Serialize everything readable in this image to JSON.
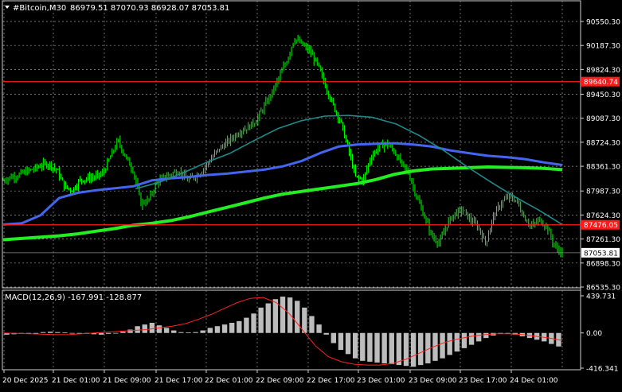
{
  "header": {
    "symbol": "#Bitcoin,M30",
    "ohlc": "86979.51 87070.93 86928.07 87053.81"
  },
  "colors": {
    "background": "#000000",
    "grid": "#9a9a9a",
    "candle": "#00ff00",
    "ma_green": "#22ee22",
    "ma_blue": "#4466ee",
    "ma_teal": "#1f8a8a",
    "hline": "#ff1a1a",
    "price_line": "#8a8a8a",
    "macd_hist": "#bdbdbd",
    "macd_signal": "#ff2020",
    "text": "#ffffff"
  },
  "chart_data": [
    {
      "type": "line",
      "title": "#Bitcoin,M30",
      "x_labels": [
        "20 Dec 2025",
        "21 Dec 01:00",
        "21 Dec 09:00",
        "21 Dec 17:00",
        "22 Dec 01:00",
        "22 Dec 09:00",
        "22 Dec 17:00",
        "23 Dec 01:00",
        "23 Dec 09:00",
        "23 Dec 17:00",
        "24 Dec 01:00"
      ],
      "y_ticks": [
        "90550.30",
        "90187.30",
        "89824.30",
        "89450.30",
        "89087.30",
        "88724.30",
        "88361.30",
        "87987.30",
        "87624.30",
        "87261.30",
        "86898.30",
        "86535.30"
      ],
      "ylim": [
        86535.3,
        90550.3
      ],
      "grid": true,
      "horizontal_lines": [
        {
          "label": "89640.74",
          "value": 89640.74
        },
        {
          "label": "87476.05",
          "value": 87476.05
        }
      ],
      "current_price": {
        "label": "87053.81",
        "value": 87053.81
      },
      "price_series": [
        88150,
        88200,
        88230,
        88280,
        88320,
        88380,
        88400,
        88300,
        88050,
        88000,
        88150,
        88180,
        88200,
        88250,
        88500,
        88750,
        88500,
        88300,
        87800,
        87850,
        88100,
        88200,
        88250,
        88300,
        88150,
        88200,
        88300,
        88450,
        88600,
        88700,
        88800,
        88900,
        88950,
        89050,
        89250,
        89450,
        89700,
        89950,
        90300,
        90200,
        90100,
        89900,
        89600,
        89300,
        89050,
        88650,
        88200,
        88150,
        88500,
        88650,
        88700,
        88600,
        88400,
        88250,
        87900,
        87600,
        87300,
        87200,
        87500,
        87650,
        87700,
        87550,
        87450,
        87200,
        87600,
        87800,
        87900,
        87850,
        87600,
        87450,
        87550,
        87450,
        87150,
        87050
      ],
      "series": [
        {
          "name": "",
          "color": "#22ee22",
          "values": [
            87250,
            87270,
            87290,
            87310,
            87340,
            87380,
            87420,
            87470,
            87500,
            87540,
            87600,
            87670,
            87740,
            87810,
            87880,
            87940,
            87980,
            88020,
            88060,
            88100,
            88160,
            88240,
            88290,
            88320,
            88330,
            88340,
            88350,
            88345,
            88340,
            88330,
            88310
          ]
        },
        {
          "name": "",
          "color": "#4466ee",
          "values": [
            87480,
            87500,
            87620,
            87880,
            87960,
            88000,
            88030,
            88060,
            88150,
            88180,
            88200,
            88230,
            88250,
            88280,
            88310,
            88360,
            88440,
            88560,
            88660,
            88690,
            88700,
            88710,
            88690,
            88660,
            88600,
            88560,
            88520,
            88500,
            88470,
            88420,
            88380
          ]
        },
        {
          "name": "",
          "color": "#1f8a8a",
          "values": [
            88020,
            88120,
            88260,
            88420,
            88560,
            88750,
            88930,
            89050,
            89120,
            89130,
            89100,
            89000,
            88820,
            88600,
            88350,
            88120,
            87900,
            87700,
            87480
          ]
        }
      ]
    },
    {
      "type": "bar",
      "title": "MACD(12,26,9) -167.991 -128.877",
      "y_ticks": [
        "439.731",
        "0.00",
        "-416.341"
      ],
      "ylim": [
        -416.341,
        439.731
      ],
      "histogram": [
        -20,
        -15,
        -10,
        -5,
        0,
        10,
        15,
        10,
        5,
        0,
        -5,
        -10,
        -15,
        -20,
        -10,
        0,
        15,
        40,
        80,
        100,
        120,
        90,
        60,
        30,
        10,
        5,
        10,
        30,
        60,
        80,
        100,
        120,
        140,
        180,
        230,
        300,
        350,
        400,
        430,
        420,
        380,
        300,
        200,
        100,
        -20,
        -120,
        -200,
        -250,
        -300,
        -330,
        -340,
        -350,
        -360,
        -370,
        -380,
        -390,
        -400,
        -380,
        -360,
        -330,
        -300,
        -260,
        -220,
        -180,
        -140,
        -100,
        -60,
        -30,
        -10,
        -5,
        -20,
        -40,
        -60,
        -80,
        -100,
        -130,
        -160
      ],
      "signal": [
        0,
        -5,
        -10,
        -15,
        -20,
        -20,
        -10,
        0,
        10,
        20,
        30,
        40,
        60,
        80,
        110,
        160,
        220,
        290,
        360,
        410,
        420,
        360,
        230,
        40,
        -150,
        -280,
        -340,
        -370,
        -380,
        -380,
        -360,
        -310,
        -240,
        -170,
        -110,
        -70,
        -40,
        -20,
        -10,
        -10,
        -20,
        -40,
        -60,
        -90
      ]
    }
  ]
}
